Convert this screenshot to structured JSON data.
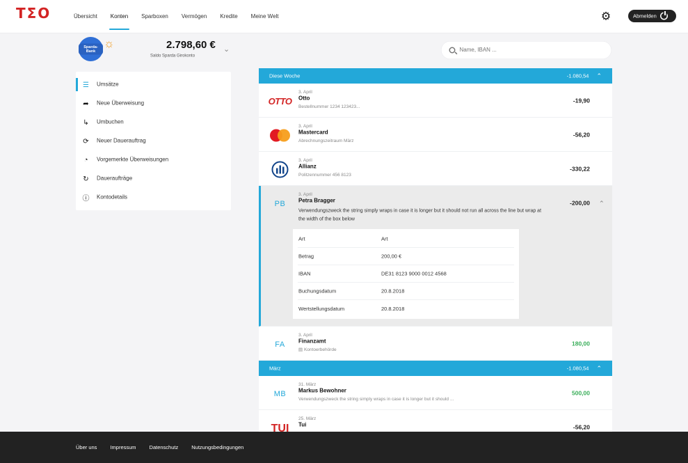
{
  "header": {
    "logo": "TΣO",
    "nav": [
      "Übersicht",
      "Konten",
      "Sparboxen",
      "Vermögen",
      "Kredite",
      "Meine Welt"
    ],
    "active_nav_index": 1,
    "logout_label": "Abmelden"
  },
  "account": {
    "bank_logo_text": "Sparda-Bank",
    "balance": "2.798,60 €",
    "balance_label": "Saldo Sparda Girokonto"
  },
  "search": {
    "placeholder": "Name, IBAN ..."
  },
  "sidebar": {
    "items": [
      {
        "label": "Umsätze",
        "icon": "list-icon",
        "active": true
      },
      {
        "label": "Neue Überweisung",
        "icon": "arrow-icon"
      },
      {
        "label": "Umbuchen",
        "icon": "turn-arrow-icon"
      },
      {
        "label": "Neuer Dauerauftrag",
        "icon": "refresh-icon"
      },
      {
        "label": "Vorgemerkte Überweisungen",
        "icon": "progress-circle-icon"
      },
      {
        "label": "Daueraufträge",
        "icon": "recurring-icon"
      },
      {
        "label": "Kontodetails",
        "icon": "info-icon"
      }
    ]
  },
  "sections": [
    {
      "title": "Diese Woche",
      "total": "-1.080,54",
      "transactions": [
        {
          "date": "3. April",
          "name": "Otto",
          "sub": "Bestellnummer 1234 123423...",
          "amount": "-19,90",
          "icon": "otto-logo",
          "logo_text": "OTTO"
        },
        {
          "date": "3. April",
          "name": "Mastercard",
          "sub": "Abrechnungszeitraum März",
          "amount": "-56,20",
          "icon": "mastercard-logo"
        },
        {
          "date": "3. April",
          "name": "Allianz",
          "sub": "Politzennummer 456 8123",
          "amount": "-330,22",
          "icon": "allianz-logo"
        },
        {
          "date": "3. April",
          "name": "Petra Bragger",
          "initials": "PB",
          "amount": "-200,00",
          "expanded": true,
          "desc": "Verwendungszweck the string simply wraps in case it is longer but it should not run all across the line but wrap at the width of the box below",
          "details": [
            {
              "k": "Art",
              "v": "Art"
            },
            {
              "k": "Betrag",
              "v": "200,00 €"
            },
            {
              "k": "IBAN",
              "v": "DE31 8123 9000 0012 4568"
            },
            {
              "k": "Buchungsdatum",
              "v": "20.8.2018"
            },
            {
              "k": "Wertstellungsdatum",
              "v": "20.8.2018"
            }
          ]
        },
        {
          "date": "3. April",
          "name": "Finanzamt",
          "initials": "FA",
          "sub": "Kontoerbehörde",
          "amount": "180,00",
          "positive": true
        }
      ]
    },
    {
      "title": "März",
      "total": "-1.080,54",
      "transactions": [
        {
          "date": "31. März",
          "name": "Markus Bewohner",
          "initials": "MB",
          "sub": "Verwendungszweck the string simply wraps in case it is longer but it should ...",
          "amount": "500,00",
          "positive": true
        },
        {
          "date": "25. März",
          "name": "Tui",
          "logo_text": "TUI",
          "amount": "-56,20",
          "icon": "tui-logo"
        }
      ]
    }
  ],
  "footer": {
    "links": [
      "Über uns",
      "Impressum",
      "Datenschutz",
      "Nutzungsbedingungen"
    ]
  }
}
